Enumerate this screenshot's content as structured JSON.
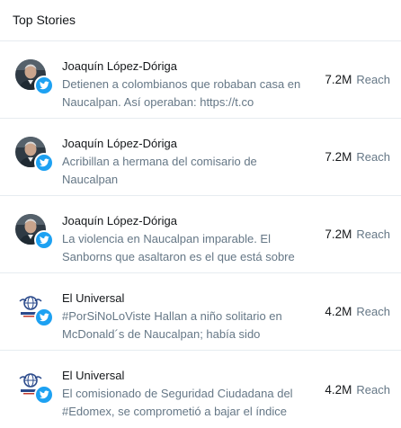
{
  "panel": {
    "title": "Top Stories"
  },
  "colors": {
    "twitter_blue": "#1da1f2",
    "secondary_text": "#657786",
    "primary_text": "#14171a",
    "divider": "#e6ecf0"
  },
  "stories": [
    {
      "author": "Joaquín López-Dóriga",
      "avatar_icon": "person-photo-avatar",
      "badge_icon": "twitter-bird-icon",
      "headline": "Detienen a colombianos que robaban casa en Naucalpan. Así operaban: https://t.co",
      "reach_value": "7.2M",
      "reach_label": "Reach"
    },
    {
      "author": "Joaquín López-Dóriga",
      "avatar_icon": "person-photo-avatar",
      "badge_icon": "twitter-bird-icon",
      "headline": "Acribillan a hermana del comisario de Naucalpan",
      "reach_value": "7.2M",
      "reach_label": "Reach"
    },
    {
      "author": "Joaquín López-Dóriga",
      "avatar_icon": "person-photo-avatar",
      "badge_icon": "twitter-bird-icon",
      "headline": "La violencia en Naucalpan imparable. El Sanborns que asaltaron es el que está sobre",
      "reach_value": "7.2M",
      "reach_label": "Reach"
    },
    {
      "author": "El Universal",
      "avatar_icon": "el-universal-logo",
      "badge_icon": "twitter-bird-icon",
      "headline": "#PorSiNoLoViste Hallan a niño solitario en McDonald´s de Naucalpan; había sido",
      "reach_value": "4.2M",
      "reach_label": "Reach"
    },
    {
      "author": "El Universal",
      "avatar_icon": "el-universal-logo",
      "badge_icon": "twitter-bird-icon",
      "headline": "El comisionado de Seguridad Ciudadana del #Edomex, se comprometió a bajar el índice",
      "reach_value": "4.2M",
      "reach_label": "Reach"
    }
  ]
}
